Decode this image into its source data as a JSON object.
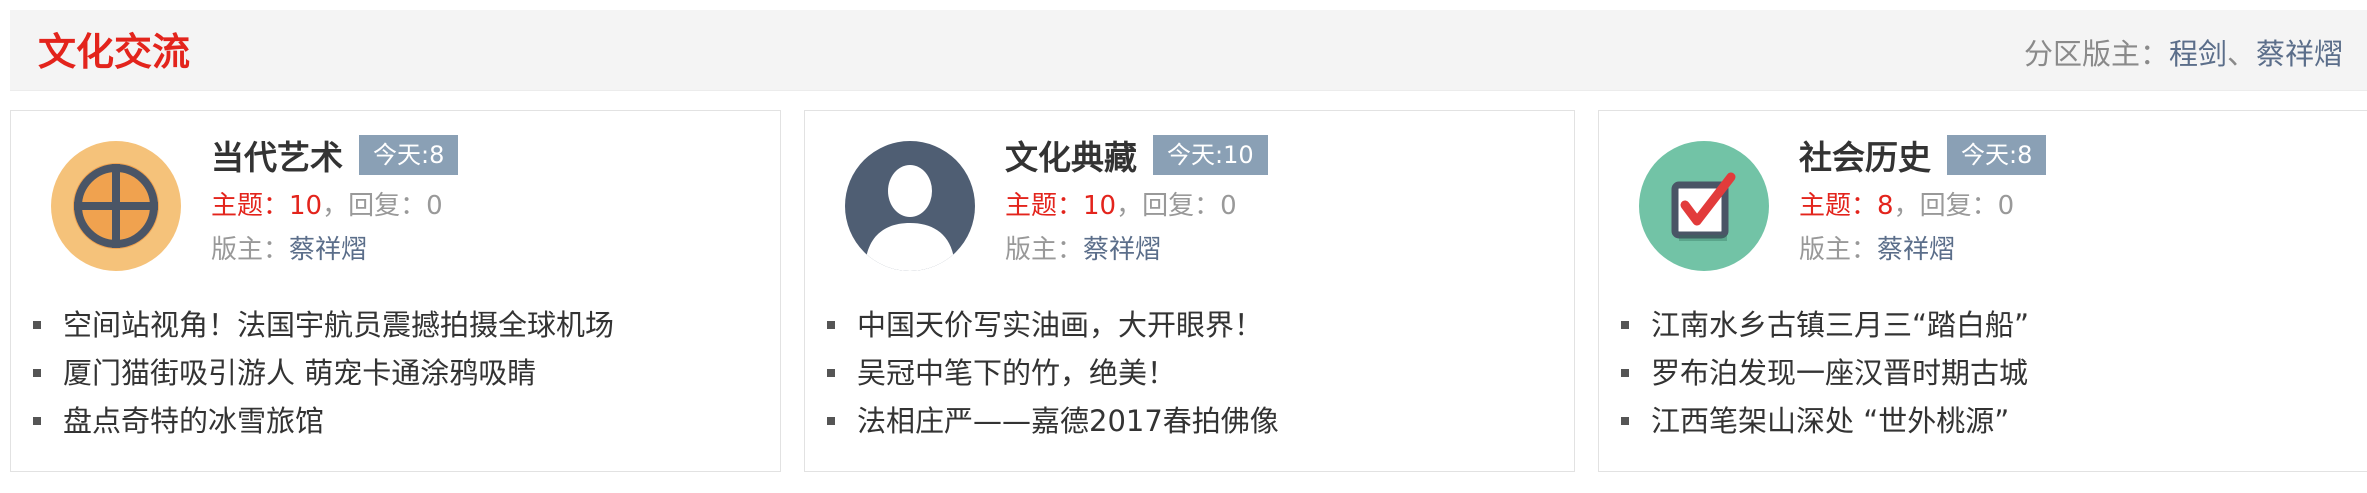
{
  "section": {
    "title": "文化交流",
    "moderators_label": "分区版主：",
    "moderators": [
      "程剑",
      "蔡祥熠"
    ],
    "moderators_sep": "、"
  },
  "boards": [
    {
      "name": "当代艺术",
      "today": "今天:8",
      "topic_label": "主题：",
      "topics": "10",
      "reply_label": "，回复：",
      "replies": "0",
      "moderator_label": "版主：",
      "moderator": "蔡祥熠",
      "icon": "target-icon",
      "icon_color": "#f5c27a",
      "posts": [
        "空间站视角！法国宇航员震撼拍摄全球机场",
        "厦门猫街吸引游人 萌宠卡通涂鸦吸睛",
        "盘点奇特的冰雪旅馆"
      ]
    },
    {
      "name": "文化典藏",
      "today": "今天:10",
      "topic_label": "主题：",
      "topics": "10",
      "reply_label": "，回复：",
      "replies": "0",
      "moderator_label": "版主：",
      "moderator": "蔡祥熠",
      "icon": "user-silhouette-icon",
      "icon_color": "#4f5e73",
      "posts": [
        "中国天价写实油画，大开眼界！",
        "吴冠中笔下的竹，绝美！",
        "法相庄严——嘉德2017春拍佛像"
      ]
    },
    {
      "name": "社会历史",
      "today": "今天:8",
      "topic_label": "主题：",
      "topics": "8",
      "reply_label": "，回复：",
      "replies": "0",
      "moderator_label": "版主：",
      "moderator": "蔡祥熠",
      "icon": "checkbox-icon",
      "icon_color": "#72c3a6",
      "posts": [
        "江南水乡古镇三月三“踏白船”",
        "罗布泊发现一座汉晋时期古城",
        "江西笔架山深处 “世外桃源”"
      ]
    }
  ],
  "colors": {
    "accent_red": "#e3241c",
    "badge_bg": "#8aa0b5",
    "link_blue": "#5b6e8a"
  }
}
